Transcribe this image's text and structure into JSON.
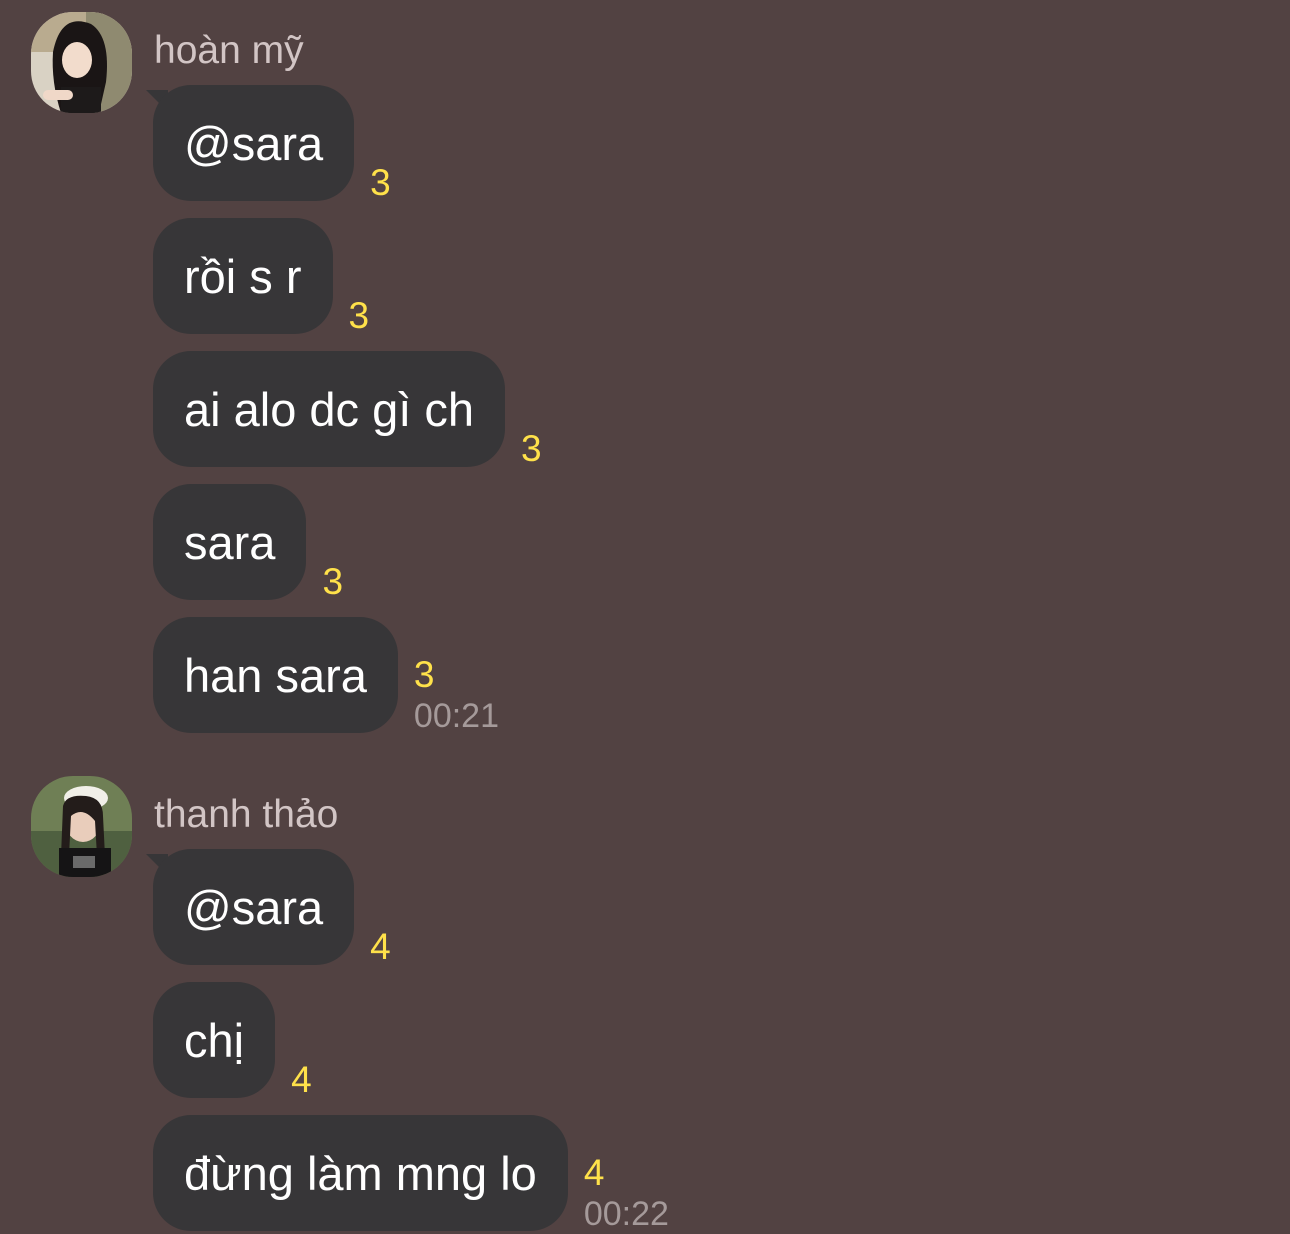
{
  "groups": [
    {
      "sender": "hoàn mỹ",
      "avatar_icon": "avatar-photo-icon",
      "messages": [
        {
          "text": "@sara",
          "read_count": "3",
          "time": ""
        },
        {
          "text": "rồi s r",
          "read_count": "3",
          "time": ""
        },
        {
          "text": "ai alo dc gì ch",
          "read_count": "3",
          "time": ""
        },
        {
          "text": "sara",
          "read_count": "3",
          "time": ""
        },
        {
          "text": "han sara",
          "read_count": "3",
          "time": "00:21"
        }
      ]
    },
    {
      "sender": "thanh thảo",
      "avatar_icon": "avatar-photo-icon",
      "messages": [
        {
          "text": "@sara",
          "read_count": "4",
          "time": ""
        },
        {
          "text": "chị",
          "read_count": "4",
          "time": ""
        },
        {
          "text": "đừng làm mng lo",
          "read_count": "4",
          "time": "00:22"
        }
      ]
    }
  ],
  "colors": {
    "background": "#524242",
    "bubble": "#373638",
    "read_count": "#ffe14a",
    "time": "#a59a9a",
    "sender_name": "#d2c5c5"
  }
}
